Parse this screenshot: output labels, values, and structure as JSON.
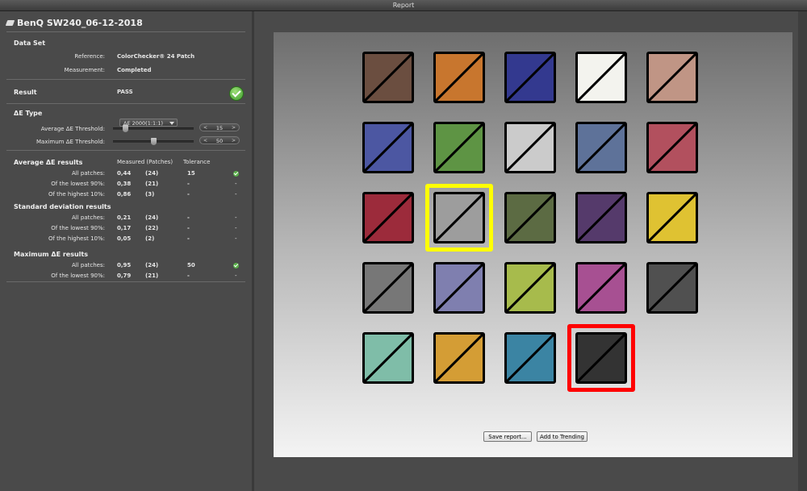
{
  "window": {
    "title": "Report"
  },
  "file": {
    "title": "BenQ SW240_06-12-2018"
  },
  "dataset": {
    "heading": "Data Set",
    "reference_label": "Reference:",
    "reference_value": "ColorChecker® 24 Patch",
    "measurement_label": "Measurement:",
    "measurement_value": "Completed"
  },
  "result": {
    "label": "Result",
    "value": "PASS"
  },
  "de_type": {
    "label": "ΔE Type",
    "selected": "ΔE 2000(1:1:1)",
    "avg_threshold_label": "Average  ΔE Threshold:",
    "avg_threshold_value": "15",
    "avg_threshold_level": 0.15,
    "max_threshold_label": "Maximum ΔE Threshold:",
    "max_threshold_value": "50",
    "max_threshold_level": 0.5
  },
  "avg_results": {
    "heading": "Average ΔE results",
    "col_measured": "Measured (Patches)",
    "col_tolerance": "Tolerance",
    "rows": [
      {
        "label": "All patches:",
        "value": "0,44",
        "patches": "(24)",
        "tolerance": "15",
        "status": "check"
      },
      {
        "label": "Of the lowest 90%:",
        "value": "0,38",
        "patches": "(21)",
        "tolerance": "-",
        "status": "-"
      },
      {
        "label": "Of the highest 10%:",
        "value": "0,86",
        "patches": "(3)",
        "tolerance": "-",
        "status": "-"
      }
    ]
  },
  "std_results": {
    "heading": "Standard deviation results",
    "rows": [
      {
        "label": "All patches:",
        "value": "0,21",
        "patches": "(24)",
        "tolerance": "-",
        "status": "-"
      },
      {
        "label": "Of the lowest 90%:",
        "value": "0,17",
        "patches": "(22)",
        "tolerance": "-",
        "status": "-"
      },
      {
        "label": "Of the highest 10%:",
        "value": "0,05",
        "patches": "(2)",
        "tolerance": "-",
        "status": "-"
      }
    ]
  },
  "max_results": {
    "heading": "Maximum ΔE results",
    "rows": [
      {
        "label": "All patches:",
        "value": "0,95",
        "patches": "(24)",
        "tolerance": "50",
        "status": "check"
      },
      {
        "label": "Of the lowest 90%:",
        "value": "0,79",
        "patches": "(21)",
        "tolerance": "-",
        "status": "-"
      }
    ]
  },
  "patches": [
    {
      "color": "#6b4e40",
      "highlight": "none"
    },
    {
      "color": "#c8762e",
      "highlight": "none"
    },
    {
      "color": "#33398f",
      "highlight": "none"
    },
    {
      "color": "#f3f3ee",
      "highlight": "none"
    },
    {
      "color": "#c09585",
      "highlight": "none"
    },
    {
      "color": "#4c57a2",
      "highlight": "none"
    },
    {
      "color": "#5e9444",
      "highlight": "none"
    },
    {
      "color": "#cbcbcb",
      "highlight": "none"
    },
    {
      "color": "#5e7299",
      "highlight": "none"
    },
    {
      "color": "#b2505e",
      "highlight": "none"
    },
    {
      "color": "#9c2b3b",
      "highlight": "none"
    },
    {
      "color": "#9d9d9d",
      "highlight": "yellow"
    },
    {
      "color": "#5c6b43",
      "highlight": "none"
    },
    {
      "color": "#553a6b",
      "highlight": "none"
    },
    {
      "color": "#dfc232",
      "highlight": "none"
    },
    {
      "color": "#777777",
      "highlight": "none"
    },
    {
      "color": "#7f7faf",
      "highlight": "none"
    },
    {
      "color": "#a7bb4c",
      "highlight": "none"
    },
    {
      "color": "#a75092",
      "highlight": "none"
    },
    {
      "color": "#505050",
      "highlight": "none"
    },
    {
      "color": "#7fbda8",
      "highlight": "none"
    },
    {
      "color": "#d49d35",
      "highlight": "none"
    },
    {
      "color": "#3b84a3",
      "highlight": "none"
    },
    {
      "color": "#333333",
      "highlight": "red"
    }
  ],
  "buttons": {
    "save_report": "Save report...",
    "add_trending": "Add to Trending"
  },
  "colors": {
    "highlight_yellow": "#ffff00",
    "highlight_red": "#ff0000",
    "pass_green": "#4caf34"
  }
}
